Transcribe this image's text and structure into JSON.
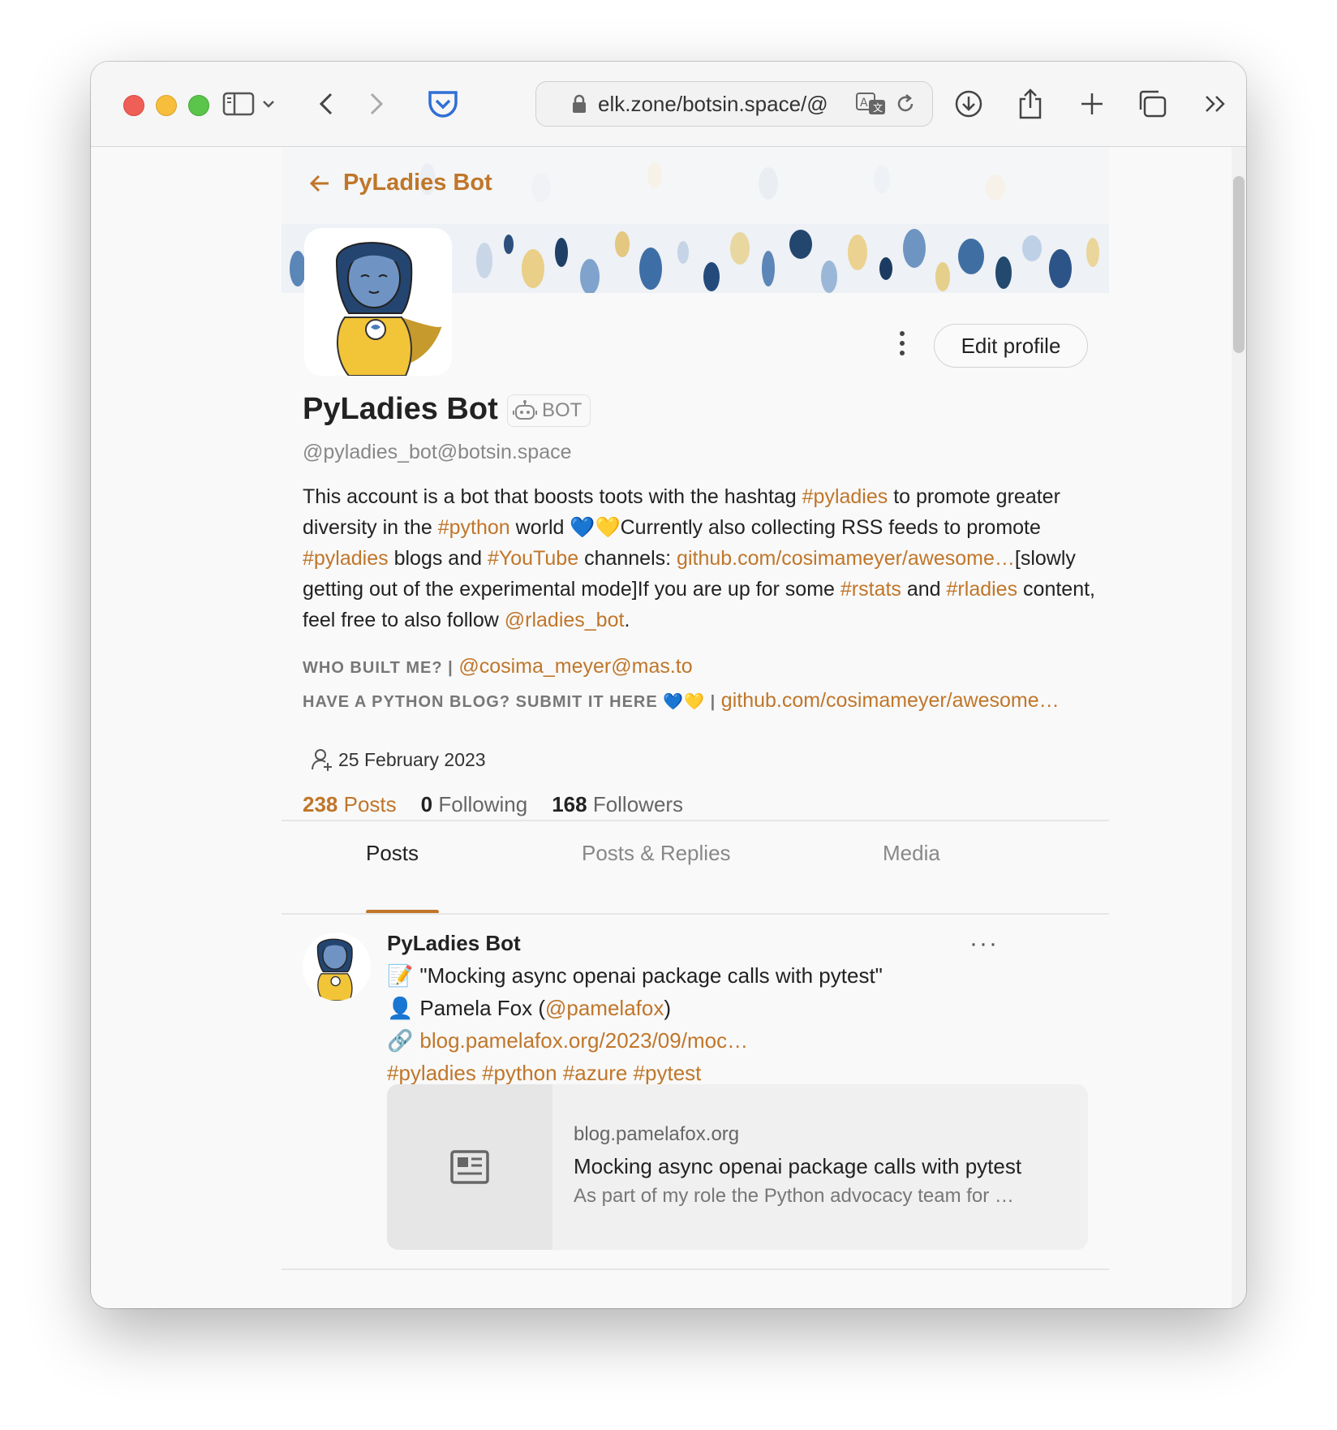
{
  "browser": {
    "url": "elk.zone/botsin.space/@",
    "accent": "#c0762a"
  },
  "header": {
    "back_title": "PyLadies Bot"
  },
  "profile": {
    "display_name": "PyLadies Bot",
    "bot_badge": "BOT",
    "handle": "@pyladies_bot@botsin.space",
    "edit_button": "Edit profile",
    "bio": {
      "p1": "This account is a bot that boosts toots with the hashtag ",
      "tag_pyladies": "#pyladies",
      "p2": " to promote greater diversity in the ",
      "tag_python": "#python",
      "p3": " world 💙💛Currently also collecting RSS feeds to promote ",
      "tag_pyladies2": "#pyladies",
      "p4": " blogs and ",
      "tag_youtube": "#YouTube",
      "p5": " channels: ",
      "link_github": "github.com/cosimameyer/awesome…",
      "p6": "[slowly getting out of the experimental mode]If you are up for some ",
      "tag_rstats": "#rstats",
      "p7": " and ",
      "tag_rladies": "#rladies",
      "p8": " content, feel free to also follow ",
      "mention_rladies": "@rladies_bot",
      "p9": "."
    },
    "fields": [
      {
        "label": "WHO BUILT ME? |",
        "value": "@cosima_meyer@mas.to"
      },
      {
        "label": "HAVE A PYTHON BLOG? SUBMIT IT HERE 💙💛 |",
        "value": "github.com/cosimameyer/awesome…"
      }
    ],
    "joined": "25 February 2023",
    "stats": {
      "posts_count": "238",
      "posts_label": "Posts",
      "following_count": "0",
      "following_label": "Following",
      "followers_count": "168",
      "followers_label": "Followers"
    }
  },
  "tabs": [
    {
      "label": "Posts",
      "active": true
    },
    {
      "label": "Posts & Replies",
      "active": false
    },
    {
      "label": "Media",
      "active": false
    }
  ],
  "post": {
    "author": "PyLadies Bot",
    "more": "···",
    "line1_emoji": "📝",
    "line1": "\"Mocking async openai package calls with pytest\"",
    "line2_emoji": "👤",
    "line2_text": "Pamela Fox (",
    "line2_mention": "@pamelafox",
    "line2_end": ")",
    "line3_emoji": "🔗",
    "line3_link": "blog.pamelafox.org/2023/09/moc…",
    "hashtags": "#pyladies #python #azure #pytest",
    "card": {
      "domain": "blog.pamelafox.org",
      "title": "Mocking async openai package calls with pytest",
      "description": "As part of my role the Python advocacy team for …"
    }
  }
}
